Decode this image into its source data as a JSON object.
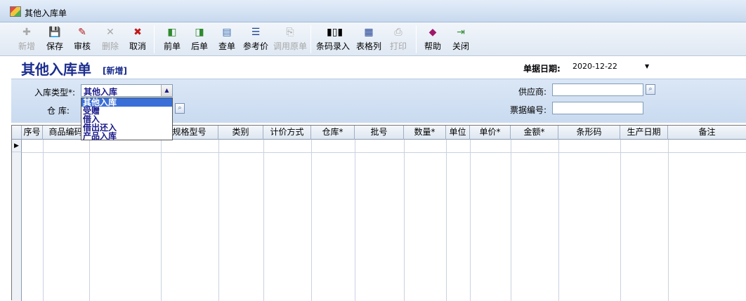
{
  "window": {
    "title": "其他入库单"
  },
  "toolbar": [
    {
      "label": "新增",
      "icon": "new-doc-icon",
      "enabled": false
    },
    {
      "label": "保存",
      "icon": "save-icon",
      "enabled": true
    },
    {
      "label": "审核",
      "icon": "approve-icon",
      "enabled": true
    },
    {
      "label": "删除",
      "icon": "delete-icon",
      "enabled": false
    },
    {
      "label": "取消",
      "icon": "cancel-icon",
      "enabled": true
    },
    {
      "label": "前单",
      "icon": "prev-doc-icon",
      "enabled": true
    },
    {
      "label": "后单",
      "icon": "next-doc-icon",
      "enabled": true
    },
    {
      "label": "查单",
      "icon": "search-doc-icon",
      "enabled": true
    },
    {
      "label": "参考价",
      "icon": "reference-price-icon",
      "enabled": true
    },
    {
      "label": "调用原单",
      "icon": "import-doc-icon",
      "enabled": false
    },
    {
      "label": "条码录入",
      "icon": "barcode-icon",
      "enabled": true
    },
    {
      "label": "表格列",
      "icon": "table-columns-icon",
      "enabled": true
    },
    {
      "label": "打印",
      "icon": "print-icon",
      "enabled": false
    },
    {
      "label": "帮助",
      "icon": "help-book-icon",
      "enabled": true
    },
    {
      "label": "关闭",
      "icon": "exit-icon",
      "enabled": true
    }
  ],
  "form": {
    "title": "其他入库单",
    "mode": "[新增]",
    "date_label": "单据日期:",
    "date_value": "2020-12-22",
    "type_label": "入库类型*:",
    "type_value": "其他入库",
    "warehouse_label": "仓    库:",
    "supplier_label": "供应商:",
    "supplier_value": "",
    "ticket_label": "票据编号:",
    "ticket_value": "",
    "type_options": [
      "其他入库",
      "受赠",
      "借入",
      "借出还入",
      "产品入库"
    ]
  },
  "grid": {
    "columns": [
      "序号",
      "商品编码",
      "",
      "规格型号",
      "类别",
      "计价方式",
      "仓库*",
      "批号",
      "数量*",
      "单位",
      "单价*",
      "金额*",
      "条形码",
      "生产日期",
      "备注"
    ]
  }
}
